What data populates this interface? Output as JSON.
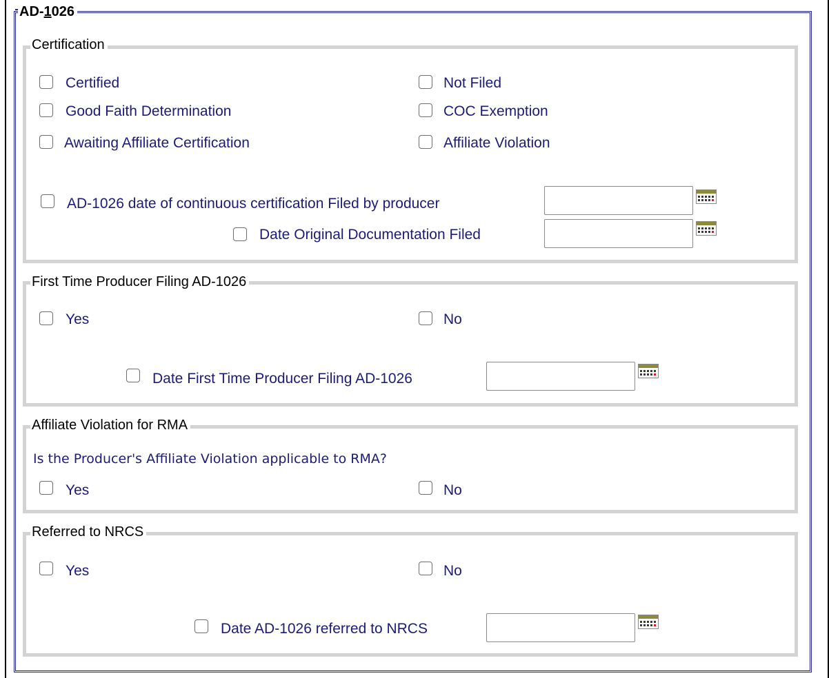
{
  "form": {
    "title_prefix": "AD-",
    "title_underlined": "1",
    "title_suffix": "026"
  },
  "certification": {
    "legend": "Certification",
    "options": {
      "certified": "Certified",
      "not_filed": "Not Filed",
      "good_faith": "Good Faith Determination",
      "coc_exemption": "COC Exemption",
      "awaiting_affiliate": "Awaiting Affiliate Certification",
      "affiliate_violation": "Affiliate Violation"
    },
    "continuous_date_label": "AD-1026 date of continuous certification Filed by producer",
    "continuous_date_value": "",
    "original_doc_label": "Date Original Documentation Filed",
    "original_doc_value": ""
  },
  "first_time": {
    "legend": "First Time Producer Filing AD-1026",
    "yes": "Yes",
    "no": "No",
    "date_label": "Date First Time Producer Filing AD-1026",
    "date_value": ""
  },
  "affiliate_rma": {
    "legend": "Affiliate Violation for RMA",
    "question": "Is the Producer's Affiliate Violation applicable to RMA?",
    "yes": "Yes",
    "no": "No"
  },
  "nrcs": {
    "legend": "Referred to NRCS",
    "yes": "Yes",
    "no": "No",
    "date_label": "Date AD-1026 referred to NRCS",
    "date_value": ""
  },
  "icons": {
    "calendar": "calendar-icon"
  },
  "colors": {
    "outer_border": "#23238e",
    "section_border": "#d3d3d3",
    "label_text": "#1b1b7a"
  }
}
